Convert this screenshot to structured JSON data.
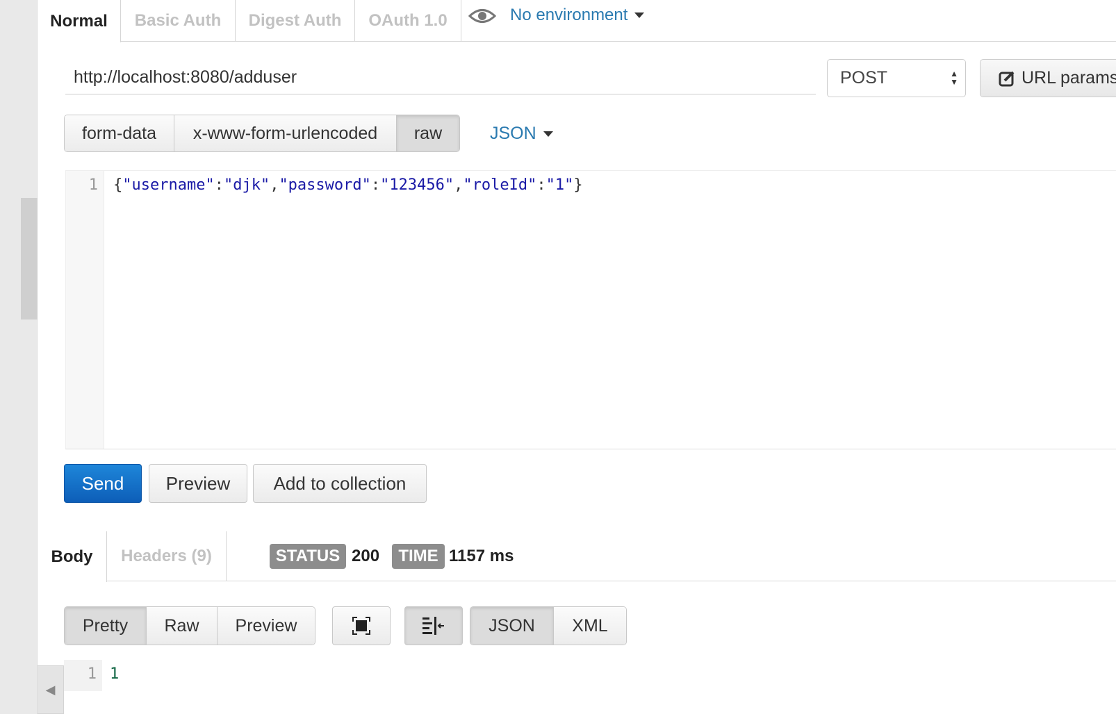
{
  "auth_tabs": [
    "Normal",
    "Basic Auth",
    "Digest Auth",
    "OAuth 1.0"
  ],
  "environment": {
    "label": "No environment",
    "icon": "eye-icon"
  },
  "request": {
    "url": "http://localhost:8080/adduser",
    "method": "POST",
    "url_params_label": "URL params"
  },
  "body_types": [
    "form-data",
    "x-www-form-urlencoded",
    "raw"
  ],
  "body_type_selected": "raw",
  "body_language": "JSON",
  "editor": {
    "line_number": "1",
    "parts": [
      "{",
      "\"username\"",
      ":",
      "\"djk\"",
      ",",
      "\"password\"",
      ":",
      "\"123456\"",
      ",",
      "\"roleId\"",
      ":",
      "\"1\"",
      "}"
    ]
  },
  "actions": {
    "send": "Send",
    "preview": "Preview",
    "add_to_collection": "Add to collection"
  },
  "response": {
    "tabs": [
      "Body",
      "Headers (9)"
    ],
    "status_label": "STATUS",
    "status_value": "200",
    "time_label": "TIME",
    "time_value": "1157 ms",
    "view_modes": [
      "Pretty",
      "Raw",
      "Preview"
    ],
    "view_mode_selected": "Pretty",
    "formats": [
      "JSON",
      "XML"
    ],
    "format_selected": "JSON",
    "line_number": "1",
    "content": "1"
  },
  "colors": {
    "accent": "#2a7ab0",
    "send": "#1170c9",
    "string": "#1a1aa6",
    "badge": "#8d8d8d"
  }
}
